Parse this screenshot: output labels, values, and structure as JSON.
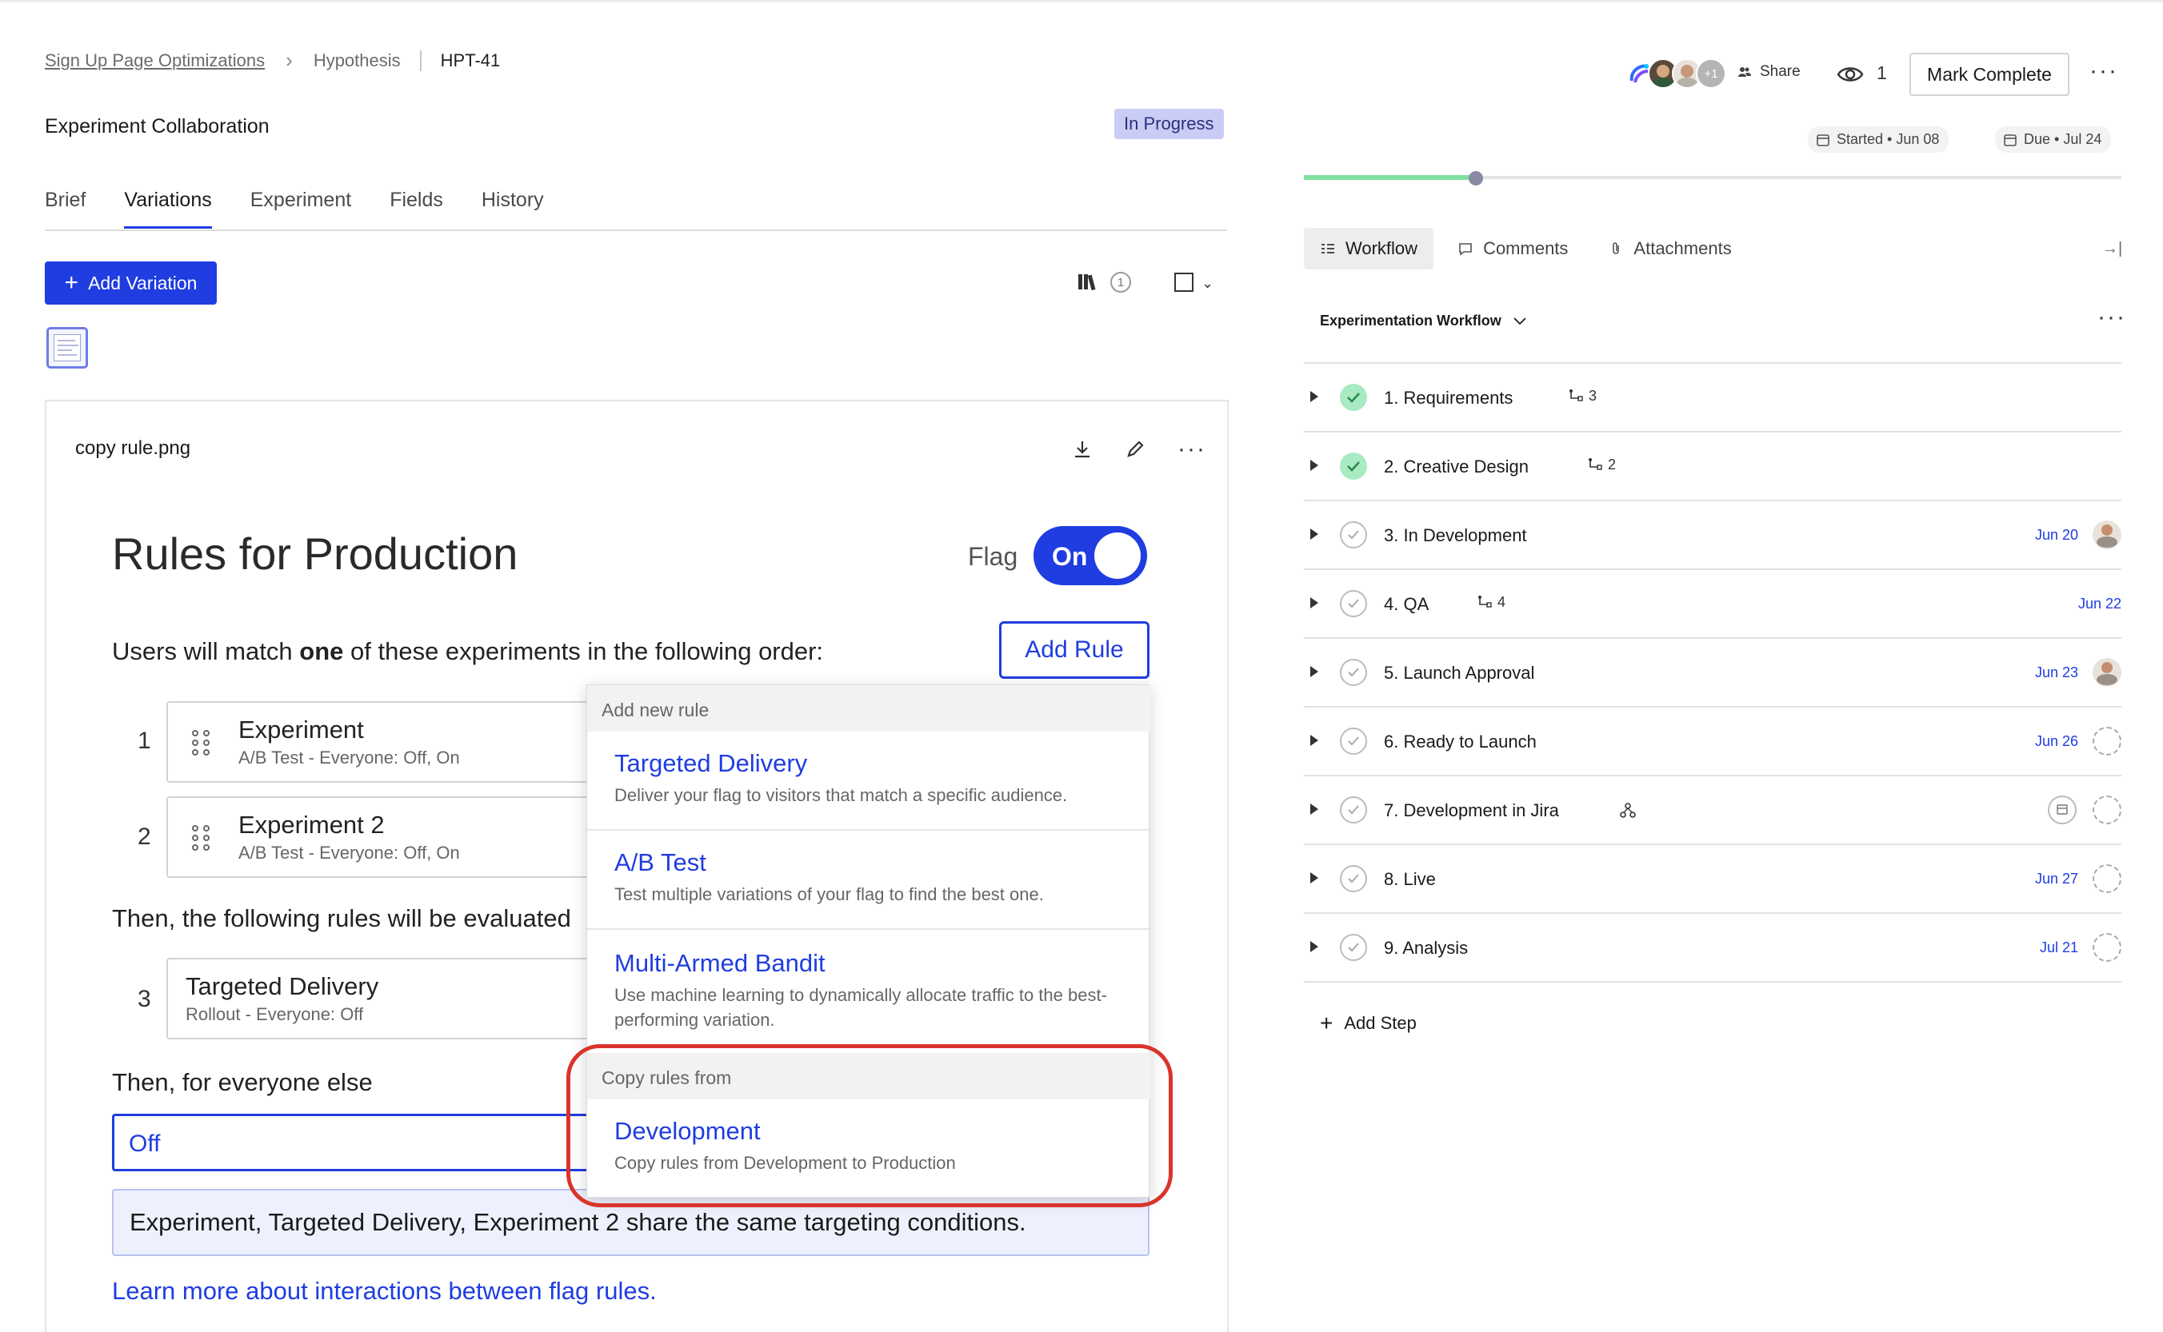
{
  "breadcrumb": {
    "project": "Sign Up Page Optimizations",
    "section": "Hypothesis",
    "id": "HPT-41"
  },
  "title": "Experiment Collaboration",
  "status": "In Progress",
  "tabs": [
    "Brief",
    "Variations",
    "Experiment",
    "Fields",
    "History"
  ],
  "active_tab": "Variations",
  "add_variation_label": "Add Variation",
  "variation_count": "1",
  "image": {
    "filename": "copy rule.png",
    "rules_title": "Rules for Production",
    "flag_label": "Flag",
    "flag_state": "On",
    "match_text_pre": "Users will match ",
    "match_text_bold": "one",
    "match_text_post": " of these experiments in the following order:",
    "add_rule_label": "Add Rule",
    "rules": [
      {
        "num": "1",
        "name": "Experiment",
        "desc": "A/B Test - Everyone: Off, On"
      },
      {
        "num": "2",
        "name": "Experiment 2",
        "desc": "A/B Test - Everyone: Off, On"
      },
      {
        "num": "3",
        "name": "Targeted Delivery",
        "desc": "Rollout - Everyone: Off"
      }
    ],
    "then_rules_text": "Then, the following rules will be evaluated",
    "then_everyone_text": "Then, for everyone else",
    "everyone_value": "Off",
    "share_note": "Experiment, Targeted Delivery, Experiment 2 share the same targeting conditions.",
    "learn_link": "Learn more about interactions between flag rules.",
    "dropdown": {
      "section_new": "Add new rule",
      "items": [
        {
          "title": "Targeted Delivery",
          "desc": "Deliver your flag to visitors that match a specific audience."
        },
        {
          "title": "A/B Test",
          "desc": "Test multiple variations of your flag to find the best one."
        },
        {
          "title": "Multi-Armed Bandit",
          "desc": "Use machine learning to dynamically allocate traffic to the best-performing variation."
        }
      ],
      "section_copy": "Copy rules from",
      "copy_item": {
        "title": "Development",
        "desc": "Copy rules from Development to Production"
      }
    }
  },
  "header_right": {
    "avatar_more": "+1",
    "share_label": "Share",
    "watchers": "1",
    "mark_complete_label": "Mark Complete",
    "started": "Started • Jun 08",
    "due": "Due • Jul 24"
  },
  "right_tabs": [
    "Workflow",
    "Comments",
    "Attachments"
  ],
  "active_right_tab": "Workflow",
  "workflow_name": "Experimentation Workflow",
  "steps": [
    {
      "label": "1.  Requirements",
      "done": true,
      "subtasks": "3",
      "date": "",
      "assignee": "none"
    },
    {
      "label": "2.  Creative Design",
      "done": true,
      "subtasks": "2",
      "date": "",
      "assignee": "none"
    },
    {
      "label": "3.  In Development",
      "done": false,
      "subtasks": "",
      "date": "Jun 20",
      "assignee": "photo"
    },
    {
      "label": "4.  QA",
      "done": false,
      "subtasks": "4",
      "date": "Jun 22",
      "assignee": "none"
    },
    {
      "label": "5.  Launch Approval",
      "done": false,
      "subtasks": "",
      "date": "Jun 23",
      "assignee": "photo"
    },
    {
      "label": "6.  Ready to Launch",
      "done": false,
      "subtasks": "",
      "date": "Jun 26",
      "assignee": "empty"
    },
    {
      "label": "7.  Development in Jira",
      "done": false,
      "subtasks": "",
      "date": "",
      "assignee": "empty"
    },
    {
      "label": "8.  Live",
      "done": false,
      "subtasks": "",
      "date": "Jun 27",
      "assignee": "empty"
    },
    {
      "label": "9.  Analysis",
      "done": false,
      "subtasks": "",
      "date": "Jul 21",
      "assignee": "empty"
    }
  ],
  "add_step_label": "Add Step",
  "progress": 0.21,
  "colors": {
    "accent": "#1f3de0",
    "done": "#a8eac1",
    "highlight": "#d9342b"
  }
}
